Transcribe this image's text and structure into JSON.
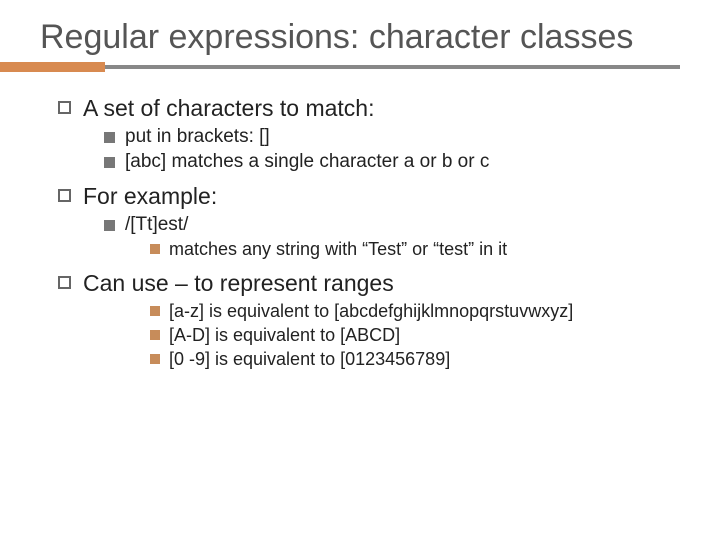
{
  "title": "Regular expressions: character classes",
  "items": [
    {
      "level": 1,
      "text": "A set of characters to match:"
    },
    {
      "level": 2,
      "text": "put in brackets: []"
    },
    {
      "level": 2,
      "text": "[abc] matches a single character a or b or c"
    },
    {
      "level": 1,
      "text": "For example:"
    },
    {
      "level": 2,
      "text": "/[Tt]est/"
    },
    {
      "level": 3,
      "text": "matches any string with “Test” or “test” in it"
    },
    {
      "level": 1,
      "text": "Can use – to represent ranges"
    },
    {
      "level": 3,
      "text": "[a-z] is equivalent to [abcdefghijklmnopqrstuvwxyz]"
    },
    {
      "level": 3,
      "text": "[A-D] is equivalent to [ABCD]"
    },
    {
      "level": 3,
      "text": "[0 -9] is equivalent to [0123456789]"
    }
  ]
}
